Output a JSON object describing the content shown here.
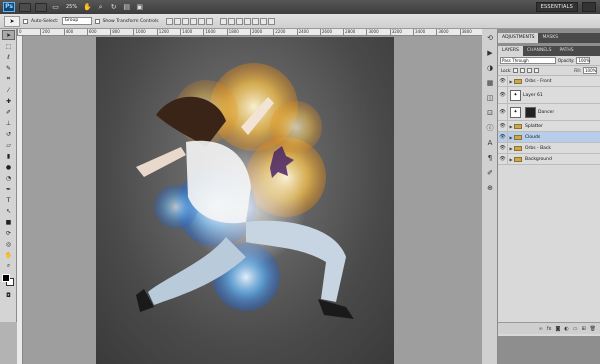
{
  "appbar": {
    "logo": "Ps",
    "zoom": "25%",
    "workspace": "ESSENTIALS",
    "icons": [
      "bridge-icon",
      "mini-bridge-icon",
      "screen-mode-icon",
      "hand-icon",
      "zoom-icon",
      "rotate-icon",
      "arrange-icon",
      "extras-icon"
    ]
  },
  "options": {
    "auto_select_label": "Auto-Select:",
    "auto_select_value": "Group",
    "transform_label": "Show Transform Controls"
  },
  "tools": [
    "move",
    "marquee",
    "lasso",
    "quick-select",
    "crop",
    "eyedropper",
    "healing",
    "brush",
    "clone",
    "history",
    "eraser",
    "gradient",
    "blur",
    "dodge",
    "pen",
    "type",
    "path-select",
    "shape",
    "3d-rotate",
    "3d-orbit",
    "hand",
    "zoom"
  ],
  "ruler": {
    "ticks": [
      "0",
      "200",
      "400",
      "600",
      "800",
      "1000",
      "1200",
      "1400",
      "1600",
      "1800",
      "2000",
      "2200",
      "2400",
      "2600",
      "2800",
      "3000",
      "3200",
      "3400",
      "3600",
      "3800"
    ]
  },
  "panels": {
    "top_tabs": [
      "ADJUSTMENTS",
      "MASKS"
    ],
    "layer_tabs": [
      "LAYERS",
      "CHANNELS",
      "PATHS"
    ],
    "blend_mode": "Pass Through",
    "opacity_label": "Opacity:",
    "opacity_value": "100%",
    "lock_label": "Lock:",
    "fill_label": "Fill:",
    "fill_value": "100%",
    "layers": [
      {
        "name": "Orbs - Front",
        "type": "group"
      },
      {
        "name": "Layer 61",
        "type": "layer"
      },
      {
        "name": "Dancer",
        "type": "masked"
      },
      {
        "name": "Splatter",
        "type": "group"
      },
      {
        "name": "Clouds",
        "type": "group",
        "selected": true
      },
      {
        "name": "Orbs - Back",
        "type": "group"
      },
      {
        "name": "Background",
        "type": "group"
      }
    ],
    "bottom_icons": [
      "link-icon",
      "fx-icon",
      "mask-icon",
      "adjustment-icon",
      "new-group-icon",
      "new-layer-icon",
      "trash-icon"
    ]
  }
}
